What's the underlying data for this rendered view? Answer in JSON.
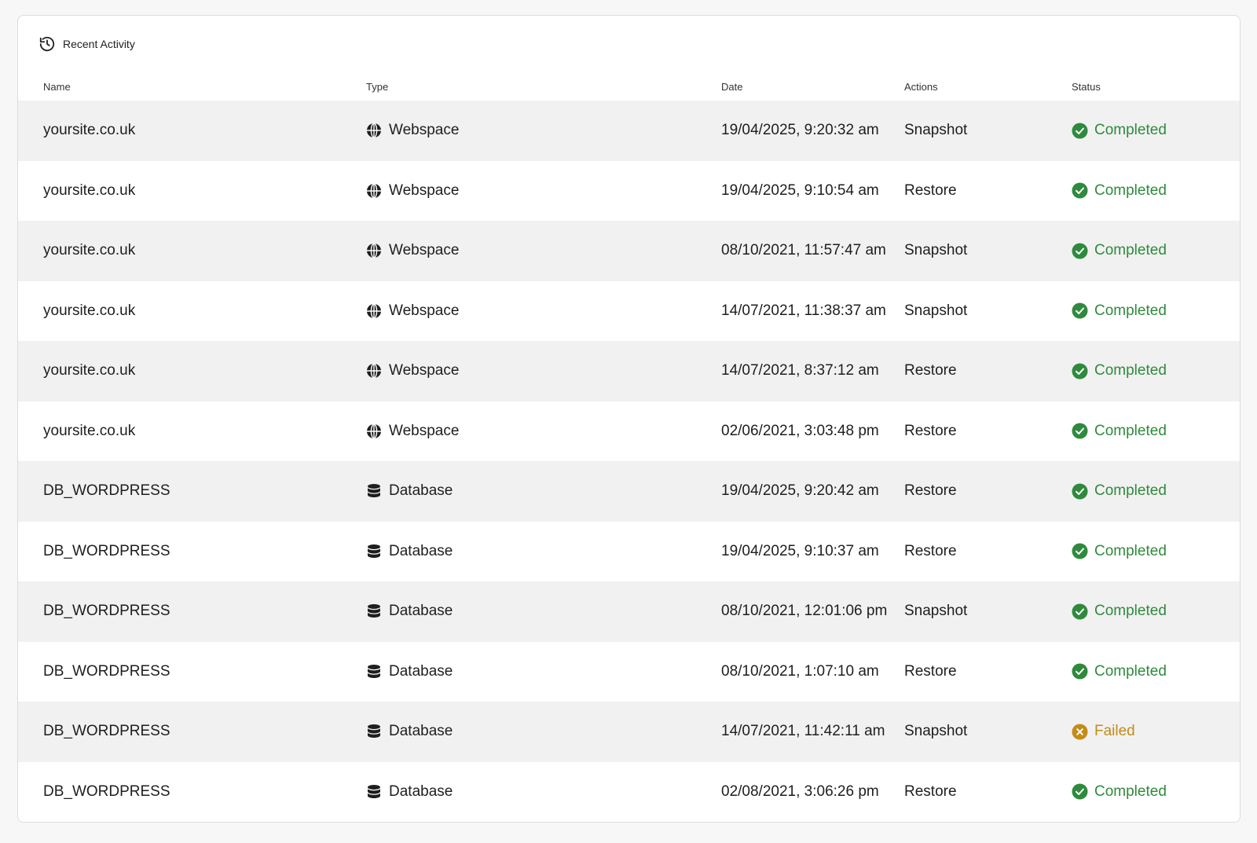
{
  "card": {
    "title": "Recent Activity",
    "icon": "history-icon"
  },
  "columns": {
    "name": "Name",
    "type": "Type",
    "date": "Date",
    "actions": "Actions",
    "status": "Status"
  },
  "colors": {
    "completed": "#2f8a3d",
    "failed": "#c48b16"
  },
  "rows": [
    {
      "name": "yoursite.co.uk",
      "type": "Webspace",
      "type_icon": "globe-icon",
      "date": "19/04/2025, 9:20:32 am",
      "action": "Snapshot",
      "status": "Completed"
    },
    {
      "name": "yoursite.co.uk",
      "type": "Webspace",
      "type_icon": "globe-icon",
      "date": "19/04/2025, 9:10:54 am",
      "action": "Restore",
      "status": "Completed"
    },
    {
      "name": "yoursite.co.uk",
      "type": "Webspace",
      "type_icon": "globe-icon",
      "date": "08/10/2021, 11:57:47 am",
      "action": "Snapshot",
      "status": "Completed"
    },
    {
      "name": "yoursite.co.uk",
      "type": "Webspace",
      "type_icon": "globe-icon",
      "date": "14/07/2021, 11:38:37 am",
      "action": "Snapshot",
      "status": "Completed"
    },
    {
      "name": "yoursite.co.uk",
      "type": "Webspace",
      "type_icon": "globe-icon",
      "date": "14/07/2021, 8:37:12 am",
      "action": "Restore",
      "status": "Completed"
    },
    {
      "name": "yoursite.co.uk",
      "type": "Webspace",
      "type_icon": "globe-icon",
      "date": "02/06/2021, 3:03:48 pm",
      "action": "Restore",
      "status": "Completed"
    },
    {
      "name": "DB_WORDPRESS",
      "type": "Database",
      "type_icon": "database-icon",
      "date": "19/04/2025, 9:20:42 am",
      "action": "Restore",
      "status": "Completed"
    },
    {
      "name": "DB_WORDPRESS",
      "type": "Database",
      "type_icon": "database-icon",
      "date": "19/04/2025, 9:10:37 am",
      "action": "Restore",
      "status": "Completed"
    },
    {
      "name": "DB_WORDPRESS",
      "type": "Database",
      "type_icon": "database-icon",
      "date": "08/10/2021, 12:01:06 pm",
      "action": "Snapshot",
      "status": "Completed"
    },
    {
      "name": "DB_WORDPRESS",
      "type": "Database",
      "type_icon": "database-icon",
      "date": "08/10/2021, 1:07:10 am",
      "action": "Restore",
      "status": "Completed"
    },
    {
      "name": "DB_WORDPRESS",
      "type": "Database",
      "type_icon": "database-icon",
      "date": "14/07/2021, 11:42:11 am",
      "action": "Snapshot",
      "status": "Failed"
    },
    {
      "name": "DB_WORDPRESS",
      "type": "Database",
      "type_icon": "database-icon",
      "date": "02/08/2021, 3:06:26 pm",
      "action": "Restore",
      "status": "Completed"
    }
  ]
}
